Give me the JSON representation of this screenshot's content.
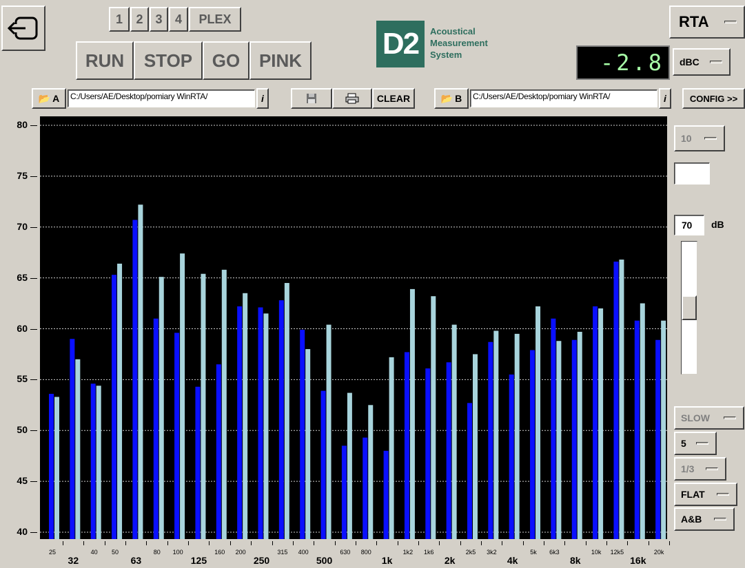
{
  "toolbar": {
    "back_icon": "exit-icon",
    "channels": [
      "1",
      "2",
      "3",
      "4",
      "PLEX"
    ],
    "run": "RUN",
    "stop": "STOP",
    "go": "GO",
    "pink": "PINK",
    "clear": "CLEAR",
    "config": "CONFIG >>",
    "save_icon": "save-icon",
    "print_icon": "printer-icon"
  },
  "logo": {
    "mark": "D2",
    "line1": "Acoustical",
    "line2": "Measurement",
    "line3": "System",
    "color": "#2e6e5e"
  },
  "files": {
    "a_label": "A",
    "a_path": "C:/Users/AE/Desktop/pomiary WinRTA/",
    "b_label": "B",
    "b_path": "C:/Users/AE/Desktop/pomiary WinRTA/",
    "info": "i",
    "open_icon": "folder-open-icon"
  },
  "mode": {
    "value": "RTA"
  },
  "readout": {
    "value": "-2.8",
    "unit": "dBC",
    "color": "#a8ffa8"
  },
  "side": {
    "range": "10",
    "ref_level": "70",
    "ref_unit": "dB",
    "slider_value": 0.5,
    "speed": "SLOW",
    "avg": "5",
    "bandwidth": "1/3",
    "weighting": "FLAT",
    "display": "A&B"
  },
  "chart_data": {
    "type": "bar",
    "ylim": [
      40,
      80
    ],
    "yticks": [
      "80",
      "75",
      "70",
      "65",
      "60",
      "55",
      "50",
      "45",
      "40"
    ],
    "grid": true,
    "categories": [
      "25",
      "32",
      "40",
      "50",
      "63",
      "80",
      "100",
      "125",
      "160",
      "200",
      "250",
      "315",
      "400",
      "500",
      "630",
      "800",
      "1k",
      "1k2",
      "1k6",
      "2k",
      "2k5",
      "3k2",
      "4k",
      "5k",
      "6k3",
      "8k",
      "10k",
      "12k5",
      "16k",
      "20k"
    ],
    "bold_labels": [
      "32",
      "63",
      "125",
      "250",
      "500",
      "1k",
      "2k",
      "4k",
      "8k",
      "16k"
    ],
    "series": [
      {
        "color": "#0a10ff",
        "values": [
          53.6,
          59.0,
          54.6,
          65.3,
          70.7,
          61.0,
          59.6,
          54.3,
          56.5,
          62.2,
          62.1,
          62.8,
          59.9,
          53.9,
          48.5,
          49.3,
          48.0,
          57.7,
          56.1,
          56.7,
          52.7,
          58.7,
          55.5,
          57.9,
          61.0,
          58.9,
          62.2,
          66.6,
          60.8,
          58.9
        ]
      },
      {
        "color": "#a8d4dc",
        "values": [
          53.3,
          57.0,
          54.4,
          66.4,
          72.2,
          65.1,
          67.4,
          65.4,
          65.8,
          63.5,
          61.5,
          64.5,
          58.0,
          60.4,
          53.7,
          52.5,
          57.2,
          63.9,
          63.2,
          60.4,
          57.5,
          59.8,
          59.5,
          62.2,
          58.8,
          59.7,
          62.0,
          66.8,
          62.5,
          60.8
        ]
      }
    ]
  }
}
